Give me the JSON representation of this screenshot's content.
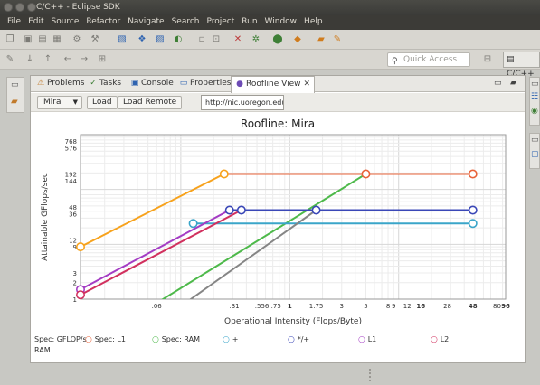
{
  "window": {
    "title": "C/C++ - Eclipse SDK"
  },
  "menu": [
    "File",
    "Edit",
    "Source",
    "Refactor",
    "Navigate",
    "Search",
    "Project",
    "Run",
    "Window",
    "Help"
  ],
  "toolbar": {
    "quick_access_placeholder": "Quick Access",
    "perspective_label": "C/C++"
  },
  "tabs": [
    {
      "label": "Problems",
      "icon": "problems-icon"
    },
    {
      "label": "Tasks",
      "icon": "tasks-icon"
    },
    {
      "label": "Console",
      "icon": "console-icon"
    },
    {
      "label": "Properties",
      "icon": "properties-icon"
    },
    {
      "label": "Roofline View",
      "icon": "roofline-icon",
      "active": true
    }
  ],
  "controls": {
    "machine_select": "Mira",
    "load_button": "Load",
    "load_remote_button": "Load Remote",
    "url_value": "http://nic.uoregon.edu/-"
  },
  "chart_data": {
    "type": "line",
    "title": "Roofline: Mira",
    "xlabel": "Operational Intensity (Flops/Byte)",
    "ylabel": "Attainable GFlops/sec",
    "x_scale": "log",
    "y_scale": "log",
    "xlim": [
      0.012,
      96
    ],
    "ylim": [
      1,
      1000
    ],
    "x_ticks": [
      ".06",
      ".31",
      ".556",
      ".75",
      "1",
      "1.75",
      "3",
      "5",
      "8",
      "9",
      "12",
      "16",
      "28",
      "48",
      "80",
      "96"
    ],
    "x_ticks_bold": [
      "1",
      "16",
      "48",
      "96"
    ],
    "y_ticks": [
      "768",
      "576",
      "192",
      "144",
      "48",
      "36",
      "12",
      "9",
      "3",
      "2",
      "1"
    ],
    "grid": true,
    "legend_position": "bottom",
    "series": [
      {
        "name": "Spec: GFLOP/s",
        "color": "#f7a21c",
        "marker": "ring",
        "points": [
          [
            0.012,
            9
          ],
          [
            0.25,
            192
          ]
        ]
      },
      {
        "name": "Spec: L1",
        "color": "#e8633a",
        "marker": "ring",
        "points": [
          [
            0.25,
            192
          ],
          [
            48,
            192
          ]
        ]
      },
      {
        "name": "Spec: RAM",
        "color": "#4db94a",
        "marker": "ring",
        "points": [
          [
            0.06,
            0.85
          ],
          [
            5,
            192
          ]
        ]
      },
      {
        "name": "+",
        "color": "#3aa5c9",
        "marker": "ring",
        "points": [
          [
            0.13,
            24
          ],
          [
            48,
            24
          ]
        ]
      },
      {
        "name": "*/+",
        "color": "#3a47b7",
        "marker": "ring",
        "points": [
          [
            0.28,
            42
          ],
          [
            48,
            42
          ]
        ]
      },
      {
        "name": "L1",
        "color": "#a43cc4",
        "marker": "ring",
        "points": [
          [
            0.012,
            1.5
          ],
          [
            0.28,
            42
          ]
        ]
      },
      {
        "name": "L2",
        "color": "#d1305e",
        "marker": "ring",
        "points": [
          [
            0.012,
            1.2
          ],
          [
            0.36,
            42
          ]
        ]
      },
      {
        "name": "RAM",
        "color": "#858585",
        "marker": "none",
        "points": [
          [
            0.11,
            0.85
          ],
          [
            1.75,
            42
          ]
        ]
      }
    ],
    "markers": [
      {
        "series": "Spec: GFLOP/s",
        "x": 0.012,
        "y": 9
      },
      {
        "series": "Spec: GFLOP/s",
        "x": 0.25,
        "y": 192
      },
      {
        "series": "Spec: L1",
        "x": 5,
        "y": 192
      },
      {
        "series": "Spec: L1",
        "x": 48,
        "y": 192
      },
      {
        "series": "+",
        "x": 0.13,
        "y": 24
      },
      {
        "series": "+",
        "x": 48,
        "y": 24
      },
      {
        "series": "*/+",
        "x": 0.28,
        "y": 42
      },
      {
        "series": "*/+",
        "x": 0.36,
        "y": 42
      },
      {
        "series": "*/+",
        "x": 1.75,
        "y": 42
      },
      {
        "series": "*/+",
        "x": 48,
        "y": 42
      },
      {
        "series": "L1",
        "x": 0.012,
        "y": 1.5
      },
      {
        "series": "L2",
        "x": 0.012,
        "y": 1.2
      }
    ]
  }
}
